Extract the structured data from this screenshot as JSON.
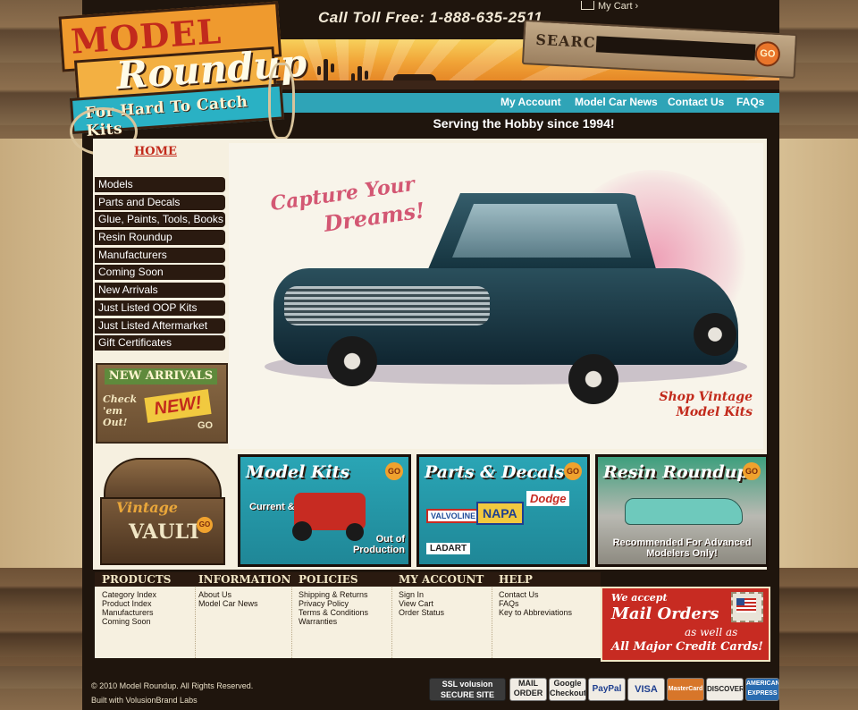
{
  "header": {
    "toll_free": "Call Toll Free: 1-888-635-2511",
    "cart_label": "My Cart",
    "search_label": "SEARCH:",
    "search_placeholder": "",
    "go_label": "GO",
    "tagline": "Serving the Hobby since 1994!"
  },
  "logo": {
    "line1": "MODEL",
    "line2": "Roundup",
    "line3": "For Hard To Catch Kits"
  },
  "topnav": [
    "My Account",
    "Model Car News",
    "Contact Us",
    "FAQs"
  ],
  "breadcrumb": "HOME",
  "sidebar": {
    "items": [
      "Models",
      "Parts and Decals",
      "Glue, Paints, Tools, Books",
      "Resin Roundup",
      "Manufacturers",
      "Coming Soon",
      "New Arrivals",
      "Just Listed OOP Kits",
      "Just Listed Aftermarket",
      "Gift Certificates"
    ]
  },
  "new_arrivals": {
    "title": "NEW ARRIVALS",
    "check": "Check 'em Out!",
    "new": "NEW!",
    "go": "GO"
  },
  "hero": {
    "cap1": "Capture Your",
    "cap2": "Dreams!",
    "shop": "Shop Vintage Model Kits"
  },
  "tiles": {
    "vault_1": "Vintage",
    "vault_2": "VAULT",
    "vault_go": "GO",
    "model_kits": "Model Kits",
    "model_sub1": "Current &",
    "model_sub2": "Out of Production",
    "parts": "Parts & Decals",
    "parts_brands": [
      "VALVOLINE",
      "NAPA",
      "Dodge",
      "LADART"
    ],
    "resin": "Resin Roundup",
    "resin_sub": "Recommended For Advanced Modelers Only!",
    "go": "GO"
  },
  "footer": {
    "columns": [
      {
        "heading": "PRODUCTS",
        "links": [
          "Category Index",
          "Product Index",
          "Manufacturers",
          "Coming Soon"
        ]
      },
      {
        "heading": "INFORMATION",
        "links": [
          "About Us",
          "Model Car News"
        ]
      },
      {
        "heading": "POLICIES",
        "links": [
          "Shipping & Returns",
          "Privacy Policy",
          "Terms & Conditions",
          "Warranties"
        ]
      },
      {
        "heading": "MY ACCOUNT",
        "links": [
          "Sign In",
          "View Cart",
          "Order Status"
        ]
      },
      {
        "heading": "HELP",
        "links": [
          "Contact Us",
          "FAQs",
          "Key to Abbreviations"
        ]
      }
    ],
    "mail": {
      "line1": "We accept",
      "line2": "Mail Orders",
      "line3": "as well as",
      "line4": "All Major Credit Cards!"
    },
    "copyright": "© 2010 Model Roundup. All Rights Reserved.",
    "built": "Built with VolusionBrand Labs"
  },
  "badges": [
    "SSL volusion SECURE SITE",
    "MAIL ORDER",
    "Google Checkout",
    "PayPal",
    "VISA",
    "MasterCard",
    "DISCOVER",
    "AMERICAN EXPRESS"
  ],
  "colors": {
    "accent_teal": "#2fa4b7",
    "brand_red": "#c22a1c",
    "nav_dark": "#2a1a10",
    "orange": "#ef9a2e"
  }
}
